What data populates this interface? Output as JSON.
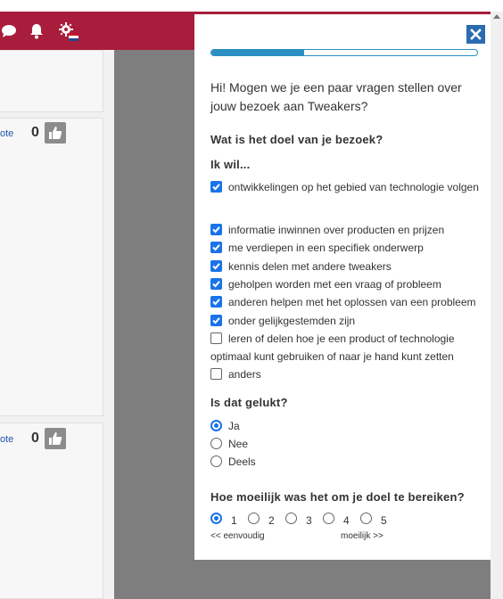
{
  "header": {
    "icons": [
      "chat-icon",
      "bell-icon",
      "settings-flag-icon"
    ],
    "color": "#a81d3b"
  },
  "left": {
    "cards": [
      {
        "vote_label": "ote",
        "count": "0"
      },
      {
        "vote_label": "ote",
        "count": "0"
      }
    ]
  },
  "survey": {
    "progress": 0.35,
    "intro": "Hi! Mogen we je een paar vragen stellen over jouw bezoek aan Tweakers?",
    "q1": "Wat is het doel van je bezoek?",
    "q1_sub": "Ik wil...",
    "goals": [
      {
        "label": "ontwikkelingen op het gebied van technologie volgen",
        "checked": true
      },
      {
        "label": "informatie inwinnen over producten en prijzen",
        "checked": true
      },
      {
        "label": "me verdiepen in een specifiek onderwerp",
        "checked": true
      },
      {
        "label": "kennis delen met andere tweakers",
        "checked": true
      },
      {
        "label": "geholpen worden met een vraag of probleem",
        "checked": true
      },
      {
        "label": "anderen helpen met het oplossen van een probleem",
        "checked": true
      },
      {
        "label": "onder gelijkgestemden zijn",
        "checked": true
      },
      {
        "label": "leren of delen hoe je een product of technologie optimaal kunt gebruiken of naar je hand kunt zetten",
        "checked": false
      },
      {
        "label": "anders",
        "checked": false
      }
    ],
    "q2": "Is dat gelukt?",
    "q2_options": [
      {
        "label": "Ja",
        "selected": true
      },
      {
        "label": "Nee",
        "selected": false
      },
      {
        "label": "Deels",
        "selected": false
      }
    ],
    "q3": "Hoe moeilijk was het om je doel te bereiken?",
    "q3_scale": [
      {
        "label": "1",
        "selected": true
      },
      {
        "label": "2",
        "selected": false
      },
      {
        "label": "3",
        "selected": false
      },
      {
        "label": "4",
        "selected": false
      },
      {
        "label": "5",
        "selected": false
      }
    ],
    "scale_low": "<< eenvoudig",
    "scale_high": "moeilijk >>",
    "accent": "#1a73e8"
  }
}
